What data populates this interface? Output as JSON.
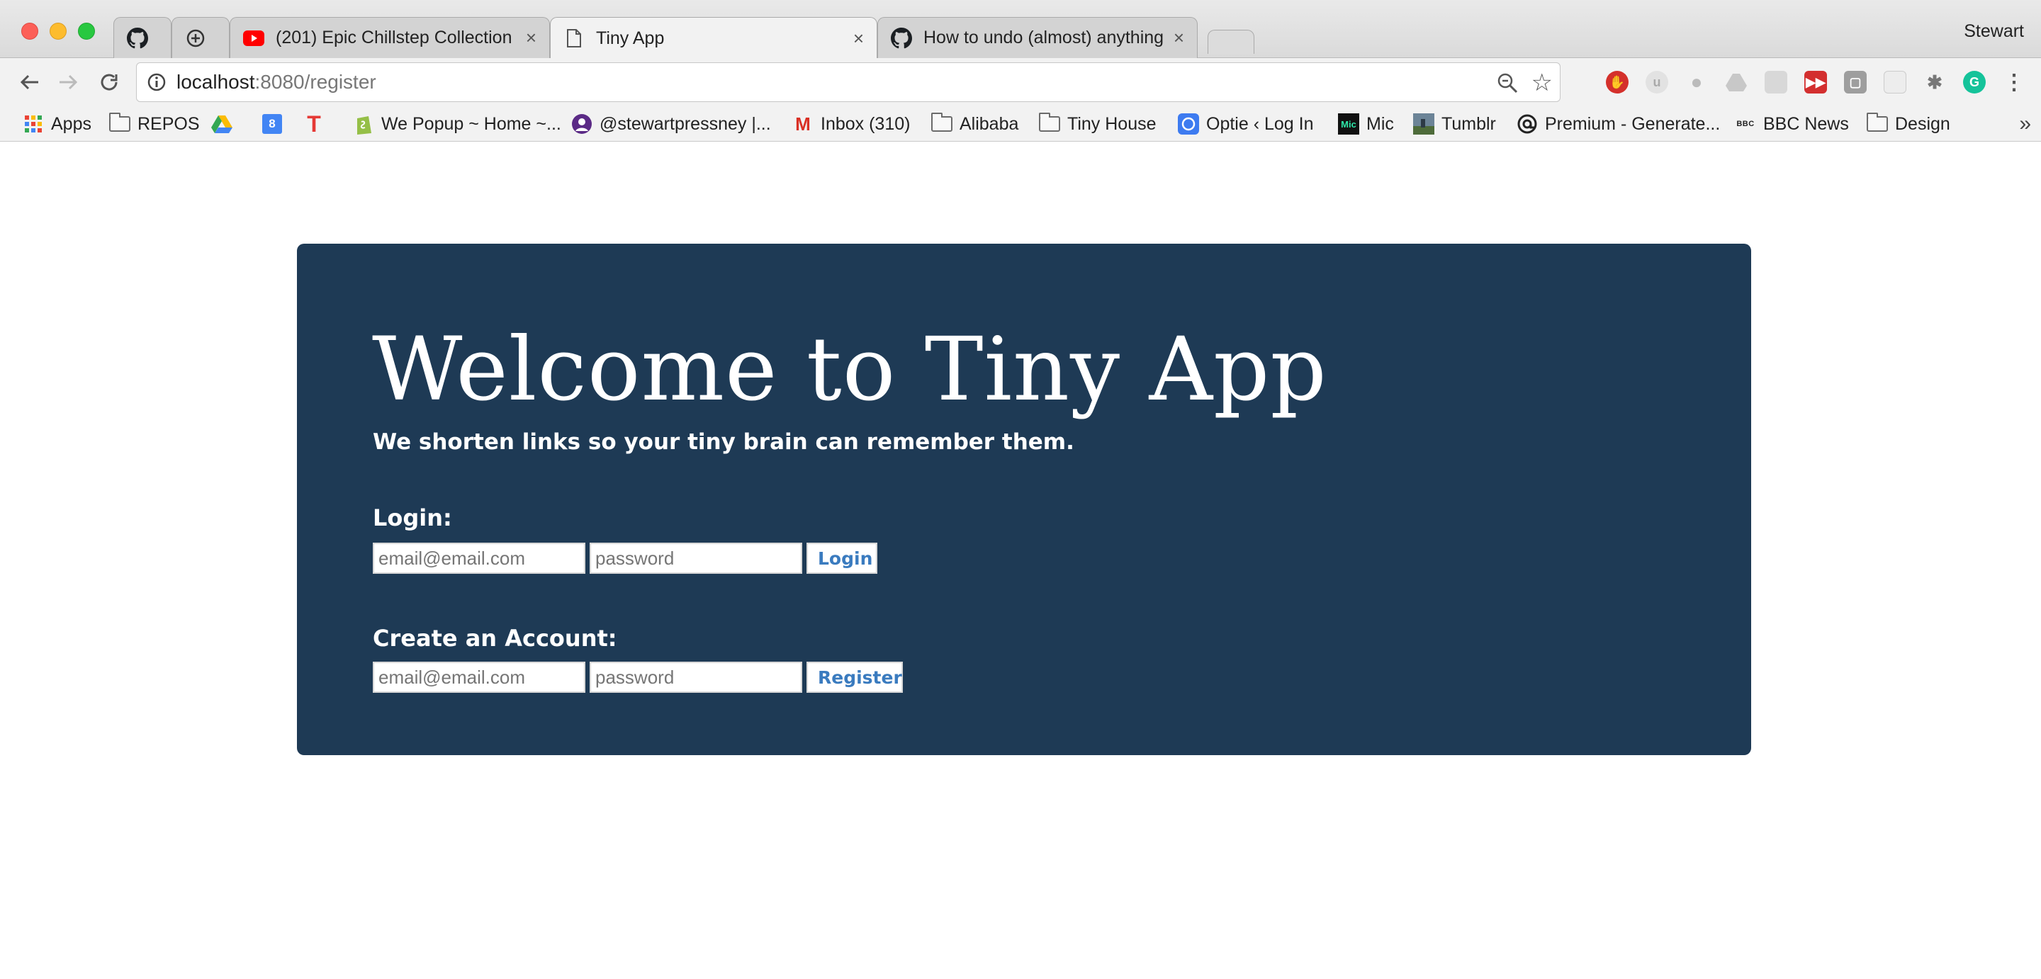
{
  "browser": {
    "profile_name": "Stewart",
    "tabs": [
      {
        "title": "",
        "icon": "github-icon"
      },
      {
        "title": "",
        "icon": "add-tab-icon"
      },
      {
        "title": "(201) Epic Chillstep Collection",
        "icon": "youtube-icon",
        "close": "×"
      },
      {
        "title": "Tiny App",
        "icon": "page-icon",
        "close": "×",
        "active": true
      },
      {
        "title": "How to undo (almost) anything",
        "icon": "github-icon",
        "close": "×"
      }
    ],
    "url_host": "localhost",
    "url_path": ":8080/register",
    "bookmarks": [
      {
        "label": "Apps",
        "icon": "apps-grid-icon"
      },
      {
        "label": "REPOS",
        "icon": "folder-icon"
      },
      {
        "label": "",
        "icon": "google-drive-icon"
      },
      {
        "label": "",
        "icon": "google-calendar-icon",
        "badge": "8"
      },
      {
        "label": "",
        "icon": "t-logo-icon",
        "badge": "T"
      },
      {
        "label": "We Popup ~ Home ~...",
        "icon": "shopify-icon"
      },
      {
        "label": "@stewartpressney |...",
        "icon": "profile-icon"
      },
      {
        "label": "Inbox (310)",
        "icon": "gmail-icon",
        "badge": "M"
      },
      {
        "label": "Alibaba",
        "icon": "folder-icon"
      },
      {
        "label": "Tiny House",
        "icon": "folder-icon"
      },
      {
        "label": "Optie ‹ Log In",
        "icon": "optie-icon"
      },
      {
        "label": "Mic",
        "icon": "mic-icon",
        "badge": "Mic"
      },
      {
        "label": "Tumblr",
        "icon": "tumblr-icon"
      },
      {
        "label": "Premium - Generate...",
        "icon": "premium-icon"
      },
      {
        "label": "BBC News",
        "icon": "bbc-icon",
        "badge": "BBC"
      },
      {
        "label": "Design",
        "icon": "folder-icon"
      }
    ],
    "bookmarks_more": "»"
  },
  "page": {
    "title": "Welcome to Tiny App",
    "subtitle": "We shorten links so your tiny brain can remember them.",
    "login": {
      "label": "Login:",
      "email_placeholder": "email@email.com",
      "password_placeholder": "password",
      "button_label": "Login"
    },
    "register": {
      "label": "Create an Account:",
      "email_placeholder": "email@email.com",
      "password_placeholder": "password",
      "button_label": "Register"
    }
  },
  "colors": {
    "jumbotron_bg": "#1e3a55",
    "button_text": "#3a7bbf"
  }
}
